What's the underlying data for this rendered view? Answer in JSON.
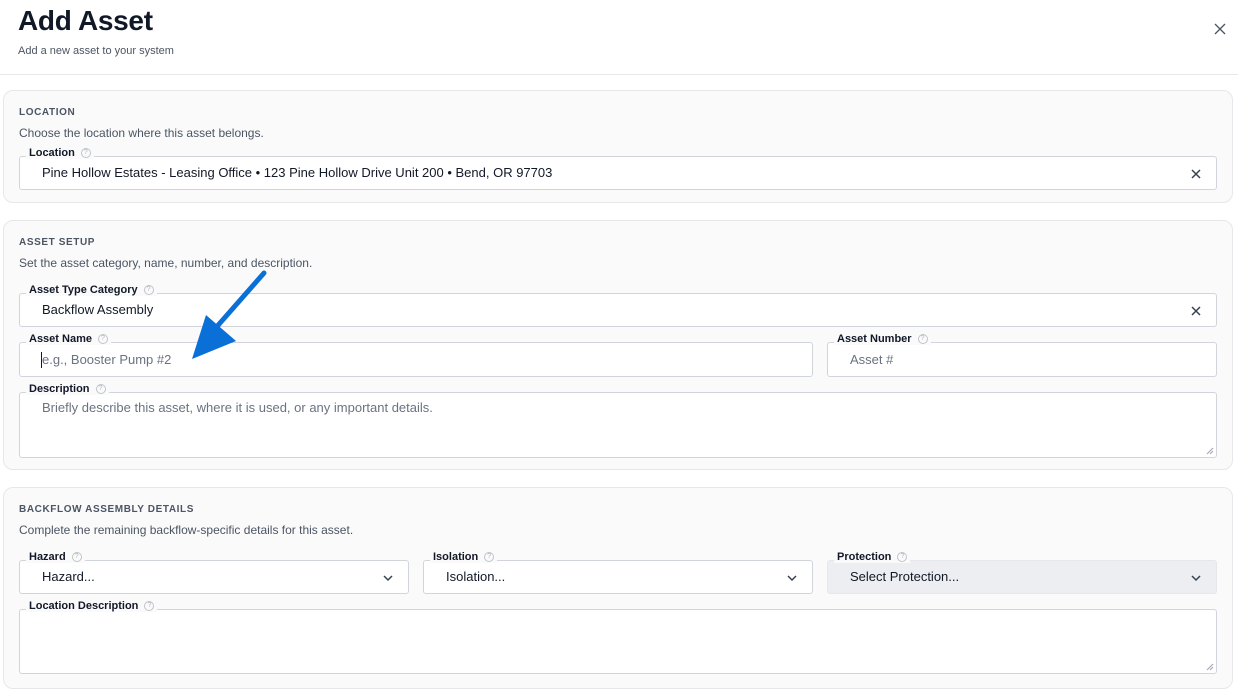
{
  "header": {
    "title": "Add Asset",
    "subtitle": "Add a new asset to your system",
    "close_icon": "close-icon"
  },
  "location_section": {
    "heading": "LOCATION",
    "description": "Choose the location where this asset belongs.",
    "location_field": {
      "label": "Location",
      "value": "Pine Hollow Estates - Leasing Office • 123 Pine Hollow Drive Unit 200 • Bend, OR 97703"
    }
  },
  "asset_setup_section": {
    "heading": "ASSET SETUP",
    "description": "Set the asset category, name, number, and description.",
    "category_field": {
      "label": "Asset Type Category",
      "value": "Backflow Assembly"
    },
    "name_field": {
      "label": "Asset Name",
      "placeholder": "e.g., Booster Pump #2"
    },
    "number_field": {
      "label": "Asset Number",
      "placeholder": "Asset #"
    },
    "description_field": {
      "label": "Description",
      "placeholder": "Briefly describe this asset, where it is used, or any important details."
    }
  },
  "backflow_section": {
    "heading": "BACKFLOW ASSEMBLY DETAILS",
    "description": "Complete the remaining backflow-specific details for this asset.",
    "hazard_field": {
      "label": "Hazard",
      "value": "Hazard..."
    },
    "isolation_field": {
      "label": "Isolation",
      "value": "Isolation..."
    },
    "protection_field": {
      "label": "Protection",
      "value": "Select Protection..."
    },
    "location_description_field": {
      "label": "Location Description",
      "value": ""
    }
  },
  "annotation": {
    "arrow_color": "#0a6fd6",
    "icon": "arrow-annotation"
  },
  "colors": {
    "accent_arrow": "#0a6fd6",
    "border": "#d1d5db",
    "card_bg": "#fafafa",
    "disabled_bg": "#eceef1"
  }
}
